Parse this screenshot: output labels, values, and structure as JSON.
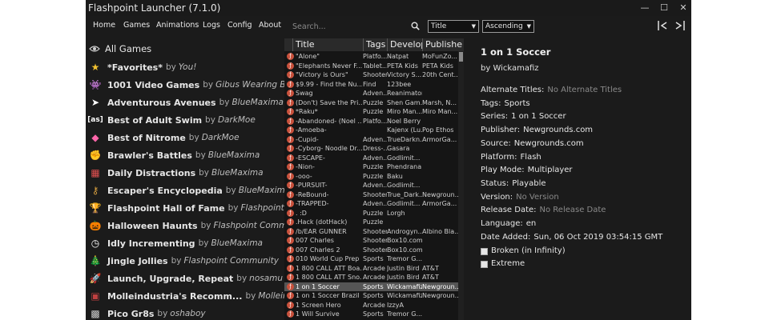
{
  "window": {
    "title": "Flashpoint Launcher (7.1.0)",
    "minimize": "—",
    "maximize": "☐",
    "close": "✕"
  },
  "menu": [
    "Home",
    "Games",
    "Animations",
    "Logs",
    "Config",
    "About"
  ],
  "search": {
    "placeholder": "Search..."
  },
  "sort_field": "Title",
  "sort_order": "Ascending",
  "sidebar": {
    "all_games": "All Games",
    "playlists": [
      {
        "title": "*Favorites*",
        "by": "by",
        "author": "You!",
        "icon": "star-icon",
        "glyph": "★",
        "color": "#f2c230"
      },
      {
        "title": "1001 Video Games",
        "by": "by",
        "author": "Gibus Wearing Brony",
        "icon": "space-invader-icon",
        "glyph": "👾",
        "color": "#ffffff"
      },
      {
        "title": "Adventurous Avenues",
        "by": "by",
        "author": "BlueMaxima",
        "icon": "cursor-icon",
        "glyph": "➤",
        "color": "#ffffff"
      },
      {
        "title": "Best of Adult Swim",
        "by": "by",
        "author": "DarkMoe",
        "icon": "adult-swim-icon",
        "glyph": "[as]",
        "color": "#ffffff"
      },
      {
        "title": "Best of Nitrome",
        "by": "by",
        "author": "DarkMoe",
        "icon": "nitrome-icon",
        "glyph": "◆",
        "color": "#ff66aa"
      },
      {
        "title": "Brawler's Battles",
        "by": "by",
        "author": "BlueMaxima",
        "icon": "fist-icon",
        "glyph": "✊",
        "color": "#e0a070"
      },
      {
        "title": "Daily Distractions",
        "by": "by",
        "author": "BlueMaxima",
        "icon": "calendar-icon",
        "glyph": "▦",
        "color": "#e05050"
      },
      {
        "title": "Escaper's Encyclopedia",
        "by": "by",
        "author": "BlueMaxima",
        "icon": "key-icon",
        "glyph": "⚷",
        "color": "#d8a040"
      },
      {
        "title": "Flashpoint Hall of Fame",
        "by": "by",
        "author": "Flashpoint Staff",
        "icon": "trophy-icon",
        "glyph": "🏆",
        "color": "#f2c230"
      },
      {
        "title": "Halloween Haunts",
        "by": "by",
        "author": "Flashpoint Community",
        "icon": "pumpkin-icon",
        "glyph": "🎃",
        "color": "#f08020"
      },
      {
        "title": "Idly Incrementing",
        "by": "by",
        "author": "BlueMaxima",
        "icon": "clock-icon",
        "glyph": "◷",
        "color": "#ffffff"
      },
      {
        "title": "Jingle Jollies",
        "by": "by",
        "author": "Flashpoint Community",
        "icon": "christmas-tree-icon",
        "glyph": "🎄",
        "color": "#40b040"
      },
      {
        "title": "Launch, Upgrade, Repeat",
        "by": "by",
        "author": "nosamu",
        "icon": "rocket-icon",
        "glyph": "🚀",
        "color": "#d0d0d0"
      },
      {
        "title": "Molleindustria's Recomm...",
        "by": "by",
        "author": "Molleind...",
        "icon": "molleindustria-icon",
        "glyph": "▣",
        "color": "#c04040"
      },
      {
        "title": "Pico Gr8s",
        "by": "by",
        "author": "oshaboy",
        "icon": "pico-icon",
        "glyph": "▩",
        "color": "#cccccc"
      }
    ]
  },
  "game_list": {
    "columns": [
      "Title",
      "Tags",
      "Develop",
      "Publishe"
    ],
    "rows": [
      [
        "\"Alone\"",
        "Platfo...",
        "Natpat",
        "MoFunZo..."
      ],
      [
        "\"Elephants Never F...",
        "Tablet...",
        "PETA Kids",
        "PETA Kids"
      ],
      [
        "\"Victory is Ours\"",
        "Shooter",
        "Victory S...",
        "20th Cent..."
      ],
      [
        "$9.99 - Find the Nu...",
        "Find",
        "123bee",
        ""
      ],
      [
        "Swag",
        "Adven...",
        "Reanimator",
        ""
      ],
      [
        "(Don't) Save the Pri...",
        "Puzzle",
        "Shen Gam...",
        "Marsh, N..."
      ],
      [
        "*Raku*",
        "Puzzle",
        "Miro Man...",
        "Miro Man..."
      ],
      [
        "-Abandoned- (Noel ...",
        "Platfo...",
        "Noel Berry",
        ""
      ],
      [
        "-Amoeba-",
        "",
        "Kajenx (Lu...",
        "Pop Ethos"
      ],
      [
        "-Cupid-",
        "Adven...",
        "TrueDarkn...",
        "ArmorGa..."
      ],
      [
        "-Cyborg- Noodle Dr...",
        "Dress-...",
        "Gasara",
        ""
      ],
      [
        "-ESCAPE-",
        "Adven...",
        "Godlimit...",
        ""
      ],
      [
        "-Nion-",
        "Puzzle",
        "Phendrana",
        ""
      ],
      [
        "-ooo-",
        "Puzzle",
        "Baku",
        ""
      ],
      [
        "-PURSUIT-",
        "Adven...",
        "Godlimit...",
        ""
      ],
      [
        "-ReBound-",
        "Shooter",
        "True_Dark...",
        "Newgroun..."
      ],
      [
        "-TRAPPED-",
        "Adven...",
        "Godlimit...",
        "ArmorGa..."
      ],
      [
        ". :D",
        "Puzzle",
        "Lorgh",
        ""
      ],
      [
        ".Hack (dotHack)",
        "Puzzle",
        "",
        ""
      ],
      [
        "/b/EAR GUNNER",
        "Shooter",
        "Androgyn...",
        "Albino Bla..."
      ],
      [
        "007 Charles",
        "Shooter",
        "Box10.com",
        ""
      ],
      [
        "007 Charles 2",
        "Shooter",
        "Box10.com",
        ""
      ],
      [
        "010 World Cup Prep",
        "Sports",
        "Tremor G...",
        ""
      ],
      [
        "1 800 CALL ATT Boa...",
        "Arcade",
        "Justin Bird",
        "AT&T"
      ],
      [
        "1 800 CALL ATT Sno...",
        "Arcade",
        "Justin Bird",
        "AT&T"
      ],
      [
        "1 on 1 Soccer",
        "Sports",
        "Wickamafiz",
        "Newgroun..."
      ],
      [
        "1 on 1 Soccer Brazil",
        "Sports",
        "Wickamafiz",
        "Newgroun..."
      ],
      [
        "1 Screen Hero",
        "Arcade",
        "IzzyA",
        ""
      ],
      [
        "1 Will Survive",
        "Sports",
        "Tremor G...",
        ""
      ]
    ],
    "selected_index": 25
  },
  "details": {
    "title": "1 on 1 Soccer",
    "by_line": "by Wickamafiz",
    "fields": [
      {
        "label": "Alternate Titles:",
        "value": "No Alternate Titles",
        "muted": true
      },
      {
        "label": "Tags:",
        "value": "Sports",
        "muted": false
      },
      {
        "label": "Series:",
        "value": "1 on 1 Soccer",
        "muted": false
      },
      {
        "label": "Publisher:",
        "value": "Newgrounds.com",
        "muted": false
      },
      {
        "label": "Source:",
        "value": "Newgrounds.com",
        "muted": false
      },
      {
        "label": "Platform:",
        "value": "Flash",
        "muted": false
      },
      {
        "label": "Play Mode:",
        "value": "Multiplayer",
        "muted": false
      },
      {
        "label": "Status:",
        "value": "Playable",
        "muted": false
      },
      {
        "label": "Version:",
        "value": "No Version",
        "muted": true
      },
      {
        "label": "Release Date:",
        "value": "No Release Date",
        "muted": true
      },
      {
        "label": "Language:",
        "value": "en",
        "muted": false
      },
      {
        "label": "Date Added:",
        "value": "Sun, 06 Oct 2019 03:54:15 GMT",
        "muted": false
      }
    ],
    "checkboxes": [
      {
        "label": "Broken (in Infinity)",
        "checked": false
      },
      {
        "label": "Extreme",
        "checked": false
      }
    ]
  }
}
